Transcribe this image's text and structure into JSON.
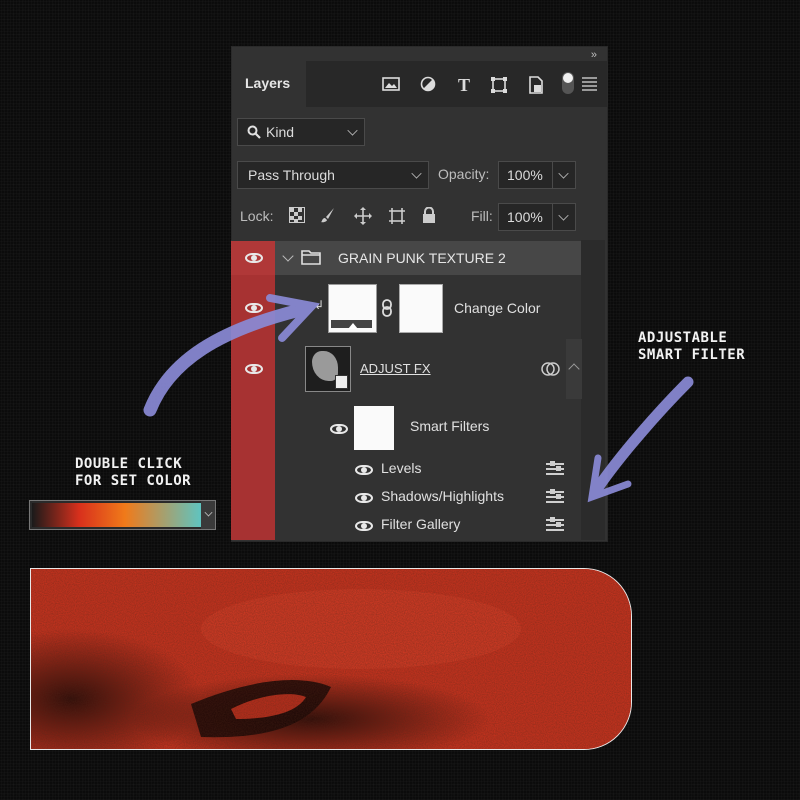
{
  "panel": {
    "collapse_glyph": "»",
    "tab_title": "Layers",
    "filter": {
      "search_icon": "search-icon",
      "kind_label": "Kind",
      "icons": [
        "image-filter-icon",
        "adjustment-filter-icon",
        "type-filter-icon",
        "shape-filter-icon",
        "smart-object-filter-icon"
      ]
    },
    "blend_mode": "Pass Through",
    "opacity_label": "Opacity:",
    "opacity_value": "100%",
    "lock_label": "Lock:",
    "fill_label": "Fill:",
    "fill_value": "100%"
  },
  "layers": {
    "group_name": "GRAIN PUNK TEXTURE 2",
    "change_color": "Change Color",
    "adjust_name": "ADJUST FX",
    "smart_filters": "Smart Filters",
    "filters": [
      "Levels",
      "Shadows/Highlights",
      "Filter Gallery"
    ]
  },
  "callouts": {
    "double_click_line1": "DOUBLE CLICK",
    "double_click_line2": "FOR SET COLOR",
    "adjustable_line1": "ADJUSTABLE",
    "adjustable_line2": "SMART FILTER"
  },
  "colors": {
    "eye_column": "#a73232",
    "photo_red": "#d2331e",
    "arrow": "#8a8ad6",
    "gradient": [
      "#1a1a1a",
      "#d8301c",
      "#f07a1a",
      "#5fc4c0"
    ]
  }
}
